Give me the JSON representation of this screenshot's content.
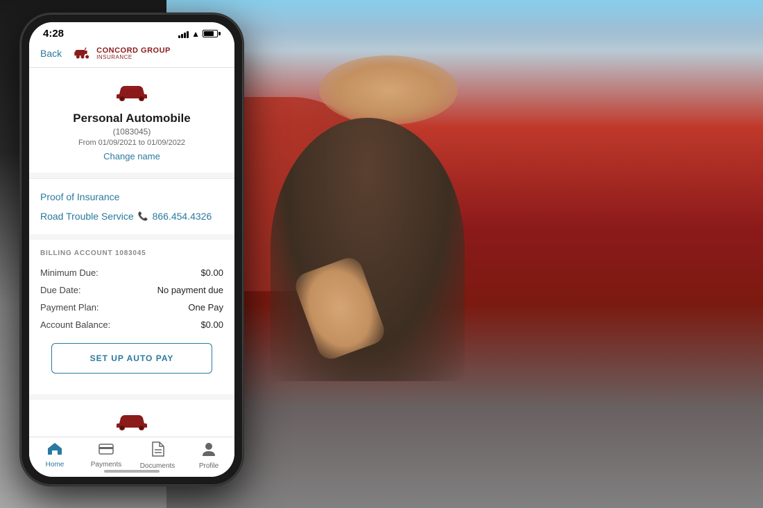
{
  "background": {
    "left_color": "#1a1a1a",
    "right_color": "#c0392b"
  },
  "status_bar": {
    "time": "4:28",
    "battery_level": "75%"
  },
  "header": {
    "back_label": "Back",
    "logo_name": "CONCORD GROUP",
    "logo_sub": "INSURANCE"
  },
  "policy": {
    "title": "Personal Automobile",
    "policy_number": "(1083045)",
    "dates": "From 01/09/2021 to 01/09/2022",
    "change_name_label": "Change name"
  },
  "links": {
    "proof_of_insurance": "Proof of Insurance",
    "road_trouble_service": "Road Trouble Service",
    "road_trouble_phone": "866.454.4326"
  },
  "billing": {
    "section_title": "BILLING ACCOUNT 1083045",
    "rows": [
      {
        "label": "Minimum Due:",
        "value": "$0.00"
      },
      {
        "label": "Due Date:",
        "value": "No payment due"
      },
      {
        "label": "Payment Plan:",
        "value": "One Pay"
      },
      {
        "label": "Account Balance:",
        "value": "$0.00"
      }
    ]
  },
  "autopay_button": {
    "label": "SET UP AUTO PAY"
  },
  "bottom_nav": [
    {
      "id": "home",
      "label": "Home",
      "active": true
    },
    {
      "id": "payments",
      "label": "Payments",
      "active": false
    },
    {
      "id": "documents",
      "label": "Documents",
      "active": false
    },
    {
      "id": "profile",
      "label": "Profile",
      "active": false
    }
  ]
}
